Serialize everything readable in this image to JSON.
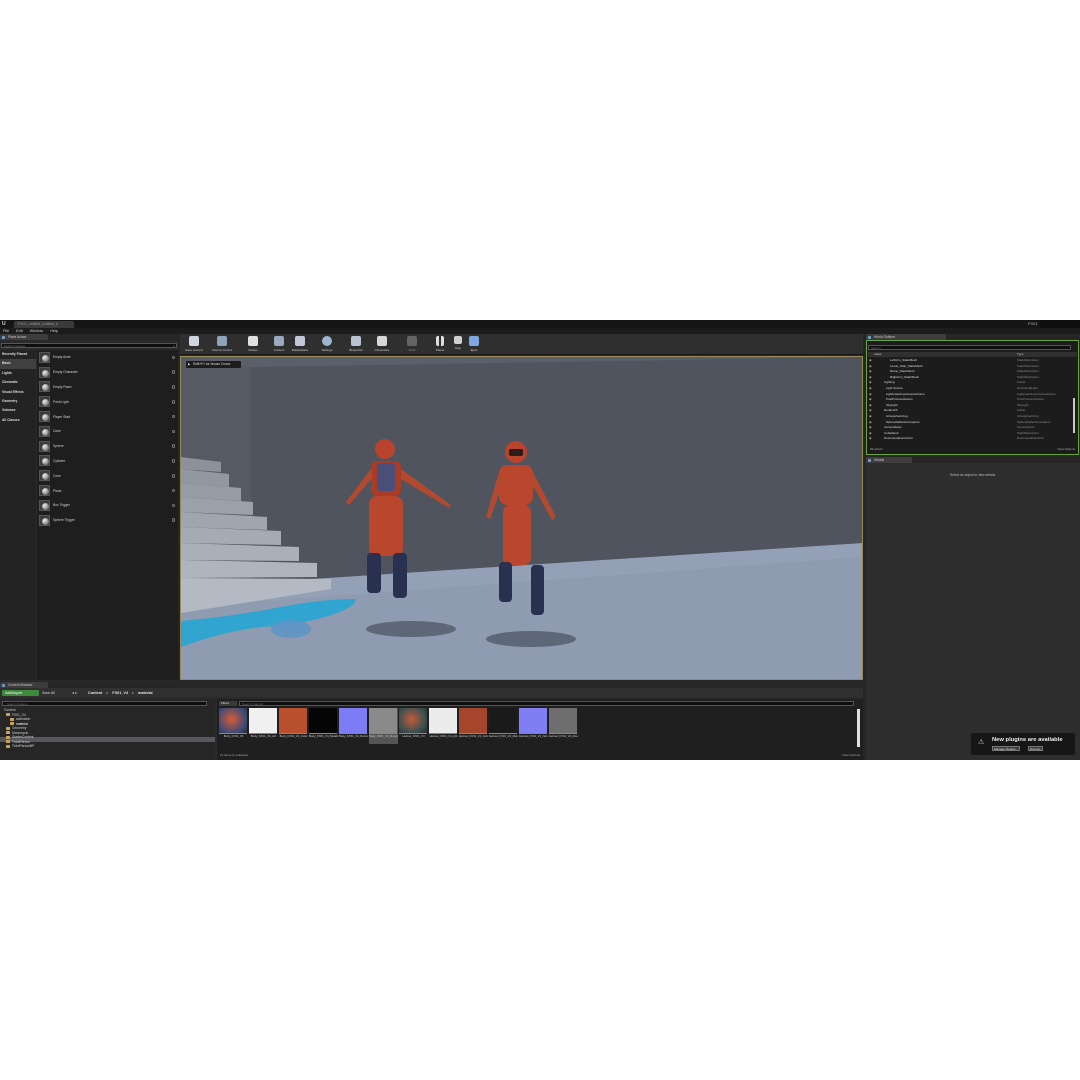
{
  "window": {
    "project_tab": "FX01_Untitled_Untitled_6",
    "project_name": "FX01"
  },
  "menu": [
    "File",
    "Edit",
    "Window",
    "Help"
  ],
  "place_actors": {
    "tab": "Place Actors",
    "search_placeholder": "Search Classes",
    "categories": [
      {
        "label": "Recently Placed"
      },
      {
        "label": "Basic"
      },
      {
        "label": "Lights"
      },
      {
        "label": "Cinematic"
      },
      {
        "label": "Visual Effects"
      },
      {
        "label": "Geometry"
      },
      {
        "label": "Volumes"
      },
      {
        "label": "All Classes"
      }
    ],
    "actors": [
      {
        "label": "Empty Actor"
      },
      {
        "label": "Empty Character"
      },
      {
        "label": "Empty Pawn"
      },
      {
        "label": "Point Light"
      },
      {
        "label": "Player Start"
      },
      {
        "label": "Cube"
      },
      {
        "label": "Sphere"
      },
      {
        "label": "Cylinder"
      },
      {
        "label": "Cone"
      },
      {
        "label": "Plane"
      },
      {
        "label": "Box Trigger"
      },
      {
        "label": "Sphere Trigger"
      }
    ]
  },
  "toolbar": [
    {
      "label": "Save Current"
    },
    {
      "label": "Source Control"
    },
    {
      "label": "Modes"
    },
    {
      "label": "Content"
    },
    {
      "label": "Marketplace"
    },
    {
      "label": "Settings"
    },
    {
      "label": "Blueprints"
    },
    {
      "label": "Cinematics"
    },
    {
      "label": "Build"
    },
    {
      "label": "Pause"
    },
    {
      "label": "Stop"
    },
    {
      "label": "Eject"
    }
  ],
  "viewport": {
    "menu_hint": "Shift+F1 for Mouse Cursor"
  },
  "content_browser": {
    "tab": "Content Browser",
    "add_import": "Add/Import",
    "save_all": "Save All",
    "breadcrumb": [
      "Content",
      "FX01_V4",
      "material"
    ],
    "tree_search_placeholder": "Search Folders",
    "tree": [
      {
        "label": "Content"
      },
      {
        "label": "FX01_V4"
      },
      {
        "label": "animation"
      },
      {
        "label": "material"
      },
      {
        "label": "Geometry"
      },
      {
        "label": "Mannequin"
      },
      {
        "label": "StarterContent"
      },
      {
        "label": "ThirdPerson"
      },
      {
        "label": "ThirdPersonBP"
      }
    ],
    "filters": "Filters",
    "asset_search_placeholder": "Search material",
    "assets": [
      {
        "label": "Body_FX01_V4"
      },
      {
        "label": "Body_FX01_V4_AO"
      },
      {
        "label": "Body_FX01_V4_Color"
      },
      {
        "label": "Body_FX01_V4_Metallic"
      },
      {
        "label": "Body_FX01_V4_Normal_DirectX"
      },
      {
        "label": "Body_FX01_V4_Roughness"
      },
      {
        "label": "Helmet_FX01_V4"
      },
      {
        "label": "Helmet_FX01_V4_AO"
      },
      {
        "label": "Helmet_FX01_V4_Color"
      },
      {
        "label": "Helmet_FX01_V4_Metallic"
      },
      {
        "label": "Helmet_FX01_V4_Normal_DirectX"
      },
      {
        "label": "Helmet_FX01_V4_Roughness"
      }
    ],
    "item_count": "12 items (1 selected)",
    "view_options": "View Options"
  },
  "world_outliner": {
    "tab": "World Outliner",
    "search_placeholder": "Search...",
    "col_label": "Label",
    "col_type": "Type",
    "rows": [
      {
        "label": "LeftArm_StaticMesh",
        "type": "StaticMeshActor"
      },
      {
        "label": "Linear_Stair_StaticMesh",
        "type": "StaticMeshActor"
      },
      {
        "label": "Ramp_StaticMesh",
        "type": "StaticMeshActor"
      },
      {
        "label": "RightArm_StaticMesh",
        "type": "StaticMeshActor"
      },
      {
        "label": "Lighting",
        "type": "Folder"
      },
      {
        "label": "Light Source",
        "type": "DirectionalLight"
      },
      {
        "label": "LightmassImportanceVolume",
        "type": "LightmassImportanceVolume"
      },
      {
        "label": "PostProcessVolume",
        "type": "PostProcessVolume"
      },
      {
        "label": "SkyLight",
        "type": "SkyLight"
      },
      {
        "label": "RenderFX",
        "type": "Folder"
      },
      {
        "label": "AtmosphericFog",
        "type": "AtmosphericFog"
      },
      {
        "label": "SphereReflectionCapture",
        "type": "SphereReflectionCapture"
      },
      {
        "label": "CameraActor",
        "type": "CameraActor"
      },
      {
        "label": "CubeMesh",
        "type": "StaticMeshActor"
      },
      {
        "label": "DocumentationActor1",
        "type": "DocumentationActor"
      }
    ],
    "actor_count": "96 actors",
    "view_options": "View Options"
  },
  "details": {
    "tab": "Details",
    "empty_message": "Select an object to view details."
  },
  "notification": {
    "title": "New plugins are available",
    "manage": "Manage Plugins...",
    "dismiss": "Dismiss"
  }
}
